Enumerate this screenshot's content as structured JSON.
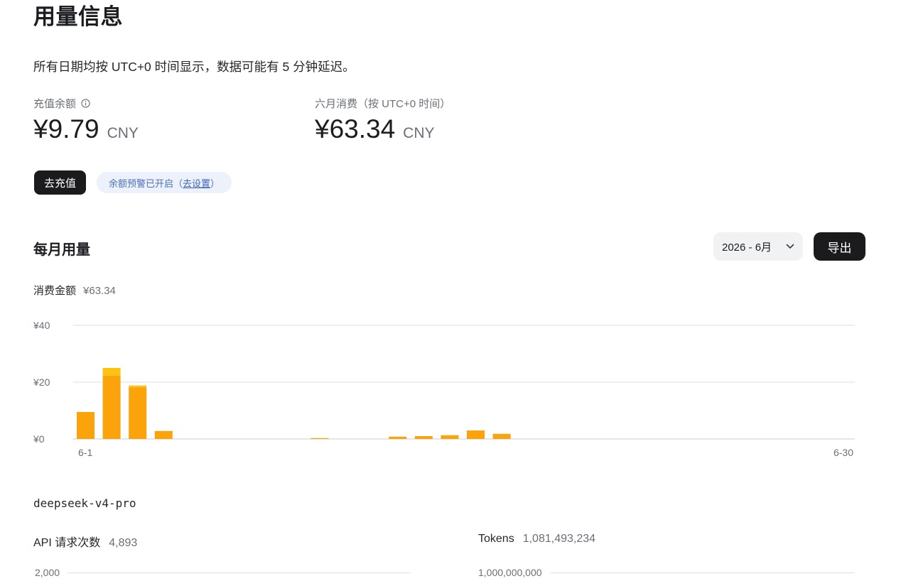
{
  "page": {
    "title": "用量信息",
    "notice": "所有日期均按 UTC+0 时间显示，数据可能有 5 分钟延迟。"
  },
  "balance": {
    "label": "充值余额",
    "amount": "¥9.79",
    "currency": "CNY",
    "icon": "info-icon"
  },
  "monthly_spend": {
    "label": "六月消费（按 UTC+0 时间）",
    "amount": "¥63.34",
    "currency": "CNY"
  },
  "actions": {
    "topup_label": "去充值",
    "alert_text": "余额预警已开启（",
    "alert_link": "去设置",
    "alert_tail": "）"
  },
  "monthly_usage": {
    "title": "每月用量",
    "month_selected": "2026 - 6月",
    "export_label": "导出",
    "cost_label": "消费金额",
    "cost_value": "¥63.34"
  },
  "colors": {
    "bar_primary": "#fba30a",
    "bar_secondary": "#fcc20f"
  },
  "chart_data": {
    "type": "bar",
    "stacked": true,
    "x_start_label": "6-1",
    "x_end_label": "6-30",
    "y_ticks": [
      "¥40",
      "¥20",
      "¥0"
    ],
    "ylim": [
      0,
      40
    ],
    "grid": true,
    "categories": [
      "6-1",
      "6-2",
      "6-3",
      "6-4",
      "6-5",
      "6-6",
      "6-7",
      "6-8",
      "6-9",
      "6-10",
      "6-11",
      "6-12",
      "6-13",
      "6-14",
      "6-15",
      "6-16",
      "6-17",
      "6-18",
      "6-19",
      "6-20",
      "6-21",
      "6-22",
      "6-23",
      "6-24",
      "6-25",
      "6-26",
      "6-27",
      "6-28",
      "6-29",
      "6-30"
    ],
    "series": [
      {
        "values": [
          9.5,
          22.3,
          18.2,
          2.8,
          0,
          0,
          0,
          0,
          0,
          0.3,
          0,
          0,
          0.8,
          1.0,
          1.3,
          3.0,
          1.8,
          0,
          0,
          0,
          0,
          0,
          0,
          0,
          0,
          0,
          0,
          0,
          0,
          0
        ]
      },
      {
        "values": [
          0,
          2.7,
          0.6,
          0,
          0,
          0,
          0,
          0,
          0,
          0,
          0,
          0,
          0,
          0,
          0,
          0,
          0,
          0,
          0,
          0,
          0,
          0,
          0,
          0,
          0,
          0,
          0,
          0,
          0,
          0
        ]
      }
    ]
  },
  "model_section": {
    "model": "deepseek-v4-pro",
    "api_label": "API 请求次数",
    "api_value": "4,893",
    "api_tick": "2,000",
    "tokens_label": "Tokens",
    "tokens_value": "1,081,493,234",
    "tokens_tick": "1,000,000,000"
  }
}
